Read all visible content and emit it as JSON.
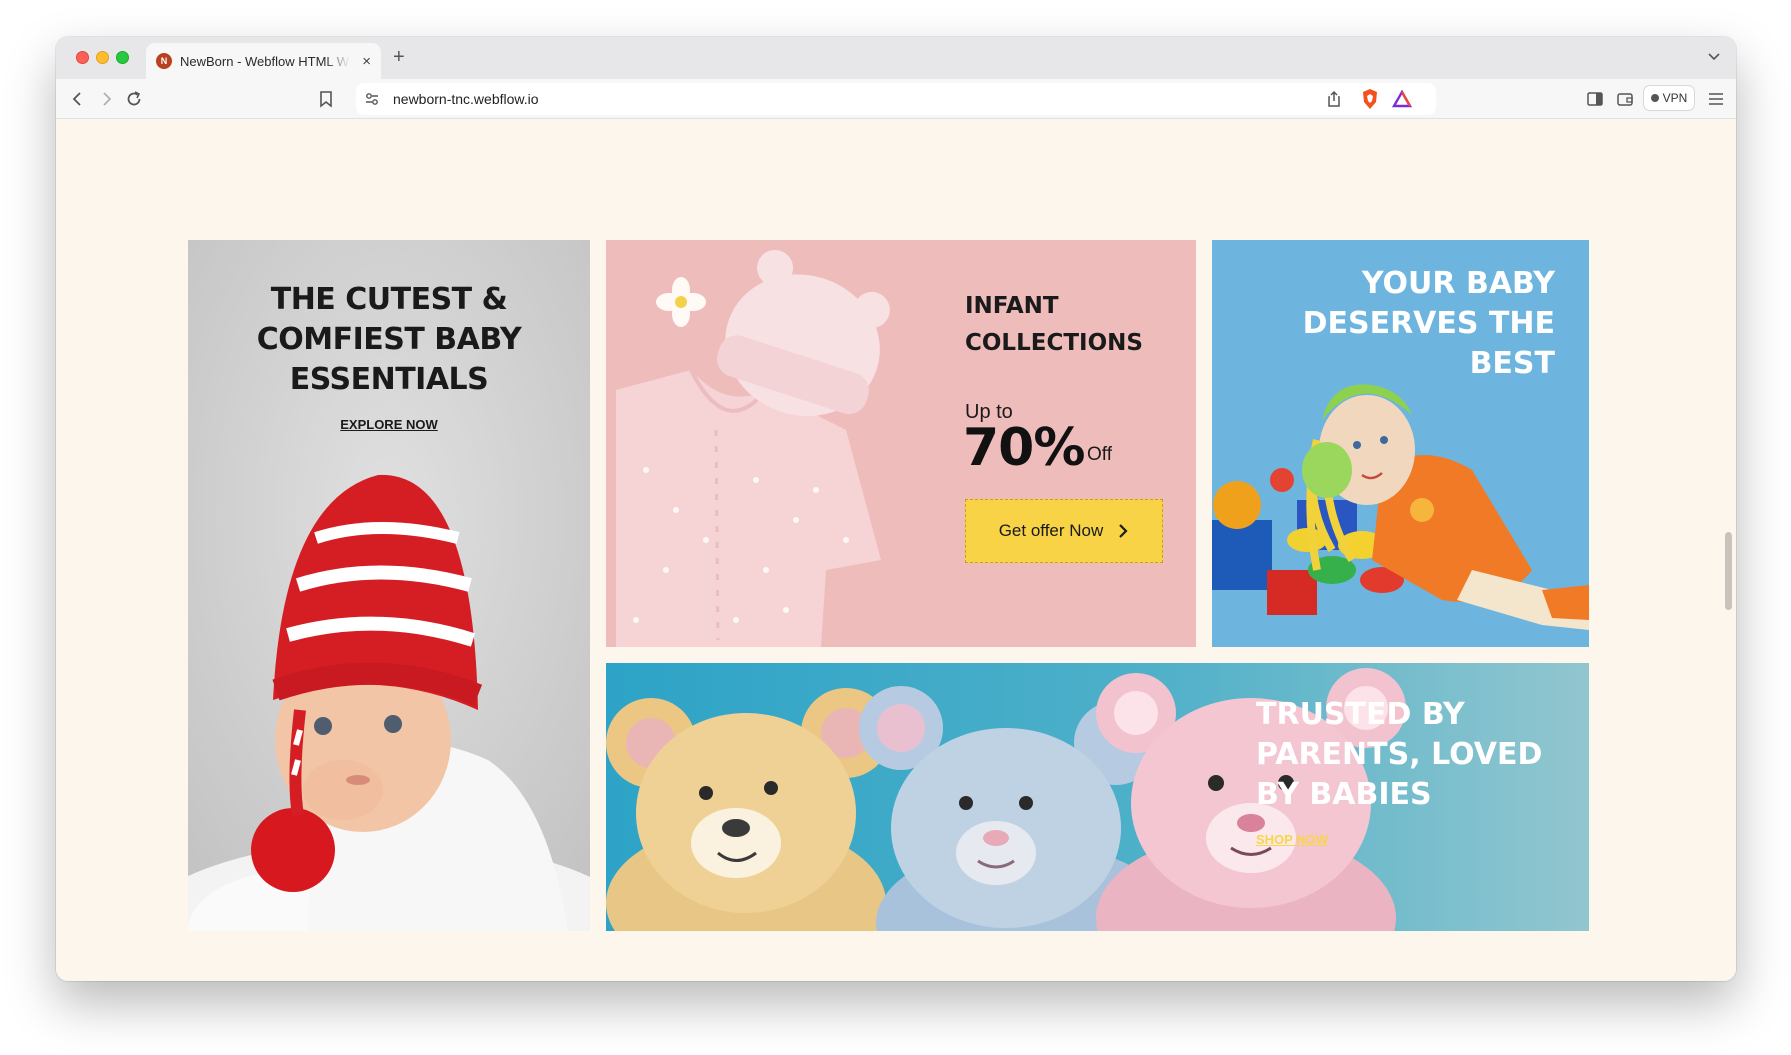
{
  "browser": {
    "tab_title": "NewBorn - Webflow HTML Website Template",
    "tab_favicon_letter": "N",
    "new_tab_label": "+",
    "close_label": "×",
    "url": "newborn-tnc.webflow.io",
    "vpn_label": "VPN"
  },
  "hero_left": {
    "title": "THE CUTEST & COMFIEST BABY ESSENTIALS",
    "link": "EXPLORE NOW"
  },
  "infant_card": {
    "title": "INFANT COLLECTIONS",
    "up_to": "Up to",
    "percent": "70%",
    "off": "Off",
    "button": "Get offer Now"
  },
  "baby_card": {
    "title": "YOUR BABY DESERVES THE BEST"
  },
  "trust_card": {
    "title": "TRUSTED BY PARENTS, LOVED BY BABIES",
    "link": "SHOP NOW"
  }
}
